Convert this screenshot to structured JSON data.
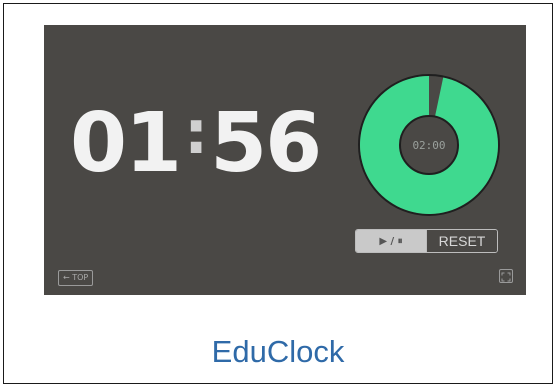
{
  "timer": {
    "minutes": "01",
    "separator": ":",
    "seconds": "56"
  },
  "donut": {
    "total_label": "02:00",
    "remaining_fraction": 0.967,
    "fill_color": "#3fd98f",
    "elapsed_color": "#4a4845"
  },
  "controls": {
    "play_pause_label": "▶ / ⏸",
    "reset_label": "RESET"
  },
  "top_button": {
    "label": "← TOP"
  },
  "fullscreen_button": {
    "icon": "fullscreen-icon"
  },
  "app": {
    "name": "EduClock"
  },
  "colors": {
    "screen_bg": "#4a4845",
    "accent_green": "#3fd98f",
    "app_name_blue": "#2f6aa8"
  }
}
